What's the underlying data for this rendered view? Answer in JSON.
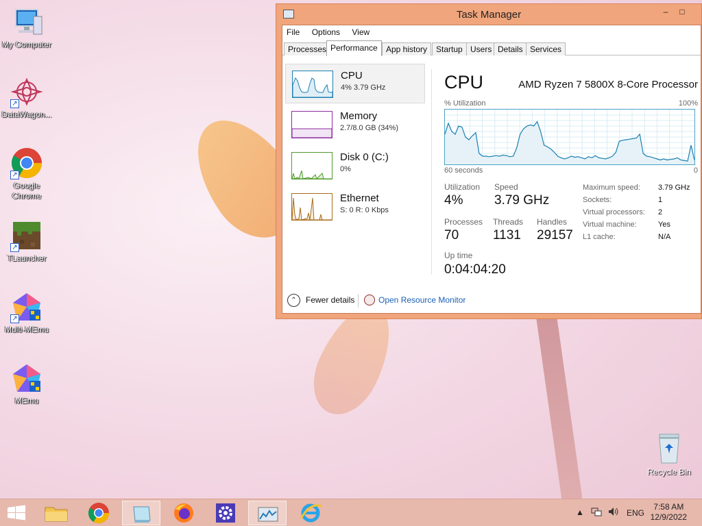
{
  "desktop": {
    "icons": [
      {
        "label": "My Computer",
        "icon": "computer-icon"
      },
      {
        "label": "DataWagon...",
        "icon": "datawagon-icon"
      },
      {
        "label": "Google Chrome",
        "icon": "chrome-icon"
      },
      {
        "label": "TLauncher",
        "icon": "minecraft-grass-icon"
      },
      {
        "label": "Multi-MEmu",
        "icon": "multi-memu-icon"
      },
      {
        "label": "MEmu",
        "icon": "memu-icon"
      }
    ],
    "recycle_bin": "Recycle Bin"
  },
  "window": {
    "title": "Task Manager",
    "minimize": "–",
    "maximize": "□",
    "menu": [
      "File",
      "Options",
      "View"
    ],
    "tabs": [
      "Processes",
      "Performance",
      "App history",
      "Startup",
      "Users",
      "Details",
      "Services"
    ],
    "active_tab": "Performance",
    "resources": [
      {
        "name": "CPU",
        "sub": "4% 3.79 GHz",
        "color": "#1a7fb0"
      },
      {
        "name": "Memory",
        "sub": "2.7/8.0 GB (34%)",
        "color": "#8b2b9e"
      },
      {
        "name": "Disk 0 (C:)",
        "sub": "0%",
        "color": "#4e9a2a"
      },
      {
        "name": "Ethernet",
        "sub": "S: 0 R: 0 Kbps",
        "color": "#a76a15"
      }
    ],
    "cpu": {
      "heading": "CPU",
      "model": "AMD Ryzen 7 5800X 8-Core Processor",
      "util_label": "% Utilization",
      "util_max": "100%",
      "time_label": "60 seconds",
      "zero_label": "0",
      "utilization_label": "Utilization",
      "utilization": "4%",
      "speed_label": "Speed",
      "speed": "3.79 GHz",
      "processes_label": "Processes",
      "processes": "70",
      "threads_label": "Threads",
      "threads": "1131",
      "handles_label": "Handles",
      "handles": "29157",
      "uptime_label": "Up time",
      "uptime": "0:04:04:20",
      "specs": [
        {
          "k": "Maximum speed:",
          "v": "3.79 GHz"
        },
        {
          "k": "Sockets:",
          "v": "1"
        },
        {
          "k": "Virtual processors:",
          "v": "2"
        },
        {
          "k": "Virtual machine:",
          "v": "Yes"
        },
        {
          "k": "L1 cache:",
          "v": "N/A"
        }
      ],
      "history": [
        55,
        75,
        60,
        55,
        70,
        68,
        50,
        45,
        52,
        58,
        20,
        15,
        15,
        14,
        15,
        16,
        15,
        17,
        16,
        14,
        15,
        30,
        55,
        65,
        70,
        72,
        70,
        78,
        60,
        35,
        32,
        28,
        22,
        15,
        12,
        10,
        12,
        15,
        13,
        14,
        12,
        10,
        14,
        12,
        16,
        12,
        11,
        10,
        12,
        15,
        22,
        42,
        44,
        45,
        46,
        47,
        48,
        55,
        20,
        15,
        14,
        12,
        10,
        8,
        10,
        8,
        9,
        10,
        12,
        8,
        7,
        6,
        35,
        8
      ]
    },
    "footer": {
      "fewer": "Fewer details",
      "resource_monitor": "Open Resource Monitor"
    }
  },
  "taskbar": {
    "tray": {
      "language": "ENG",
      "time": "7:58 AM",
      "date": "12/9/2022"
    }
  }
}
